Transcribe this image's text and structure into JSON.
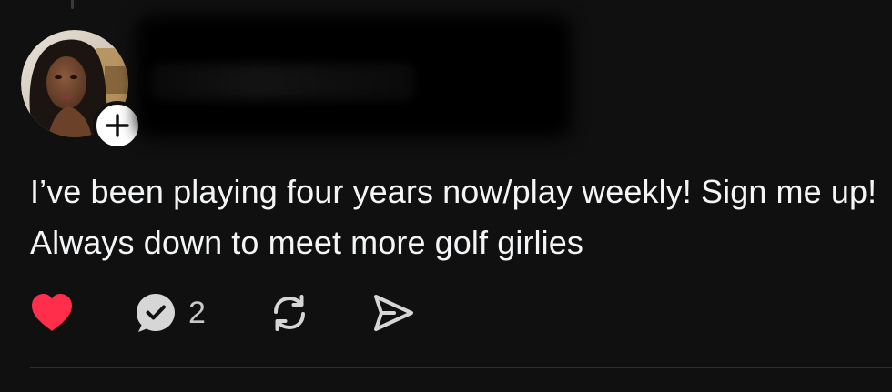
{
  "post": {
    "text": "I’ve been playing four years now/play weekly! Sign me up! Always down to meet more golf girlies",
    "avatar_icon": "profile-photo",
    "follow_icon": "plus-icon"
  },
  "actions": {
    "like_icon": "heart-filled-icon",
    "like_color": "#ff2e4a",
    "reply_icon": "reply-bubble-icon",
    "reply_count": "2",
    "repost_icon": "repost-icon",
    "share_icon": "send-icon"
  },
  "colors": {
    "background": "#101010",
    "text": "#f3f5f7",
    "icon": "#d6d6d6"
  }
}
